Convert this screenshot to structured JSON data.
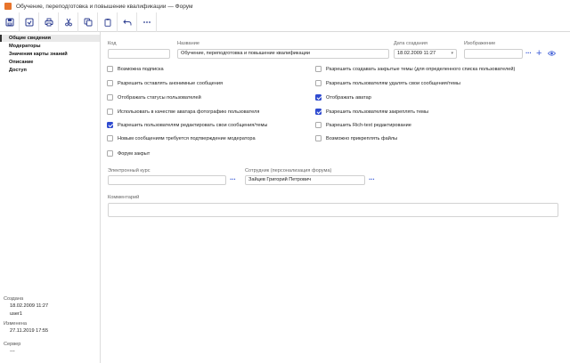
{
  "window": {
    "title": "Обучение, переподготовка и повышение квалификации — Форум"
  },
  "toolbar": {
    "buttons": [
      {
        "icon": "save-icon"
      },
      {
        "icon": "save-close-icon"
      },
      {
        "icon": "print-icon"
      },
      {
        "icon": "cut-icon"
      },
      {
        "icon": "copy-icon"
      },
      {
        "icon": "paste-icon"
      },
      {
        "icon": "undo-icon"
      },
      {
        "icon": "more-icon"
      }
    ]
  },
  "sidebar": {
    "items": [
      {
        "label": "Общие сведения",
        "active": true
      },
      {
        "label": "Модераторы"
      },
      {
        "label": "Значения карты знаний"
      },
      {
        "label": "Описание"
      },
      {
        "label": "Доступ"
      }
    ],
    "created_label": "Создана",
    "created_date": "18.02.2009 11:27",
    "created_user": "user1",
    "modified_label": "Изменена",
    "modified_date": "27.11.2019 17:55",
    "server_label": "Сервер",
    "server_value": "---"
  },
  "form": {
    "code_label": "Код",
    "code_value": "",
    "name_label": "Название",
    "name_value": "Обучение, переподготовка и повышение квалификации",
    "date_label": "Дата создания",
    "date_value": "18.02.2009 11:27",
    "image_label": "Изображение",
    "image_value": "",
    "checkboxes_left": [
      {
        "label": "Возможна подписка",
        "checked": false
      },
      {
        "label": "Разрешить оставлять анонимные сообщения",
        "checked": false
      },
      {
        "label": "Отображать статусы пользователей",
        "checked": false
      },
      {
        "label": "Использовать в качестве аватара фотографию пользователя",
        "checked": false
      },
      {
        "label": "Разрешить пользователям редактировать свои сообщения/темы",
        "checked": true
      },
      {
        "label": "Новым сообщениям требуется подтверждение модератора",
        "checked": false
      },
      {
        "label": "Форум закрыт",
        "checked": false
      }
    ],
    "checkboxes_right": [
      {
        "label": "Разрешить создавать закрытые темы (для определенного списка пользователей)",
        "checked": false
      },
      {
        "label": "Разрешить пользователям удалять свои сообщения/темы",
        "checked": false
      },
      {
        "label": "Отображать аватар",
        "checked": true
      },
      {
        "label": "Разрешить пользователям закреплять темы",
        "checked": true
      },
      {
        "label": "Разрешить Rich-text редактирование",
        "checked": false
      },
      {
        "label": "Возможно прикреплять файлы",
        "checked": false
      }
    ],
    "course_label": "Электронный курс",
    "course_value": "",
    "employee_label": "Сотрудник (персонализация форума)",
    "employee_value": "Зайцев Григорий Петрович",
    "comment_label": "Комментарий",
    "comment_value": ""
  },
  "colors": {
    "accent": "#2f4bd0",
    "app_icon": "#e8742b"
  }
}
